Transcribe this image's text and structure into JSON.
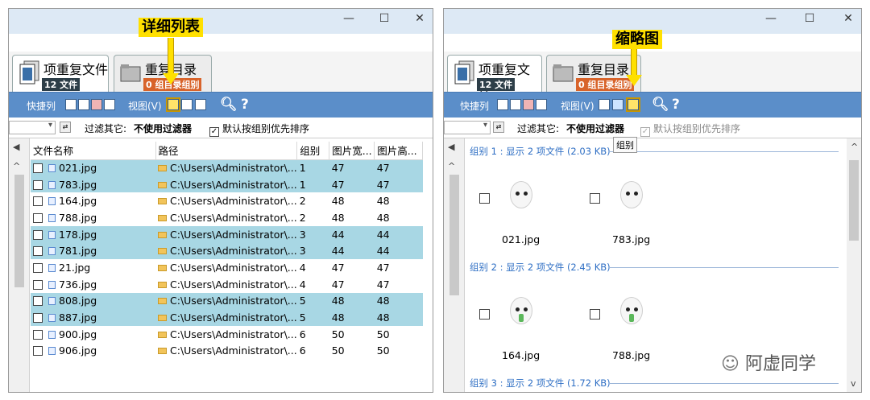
{
  "left": {
    "tabs": [
      {
        "label": "项重复文件",
        "badge": "12 文件"
      },
      {
        "label": "重复目录",
        "badge": "0 组目录组别"
      }
    ],
    "toolbar": {
      "quick": "快捷列",
      "view": "视图(V)",
      "help": "?"
    },
    "filter": {
      "other": "过滤其它:",
      "value": "不使用过滤器",
      "group_sort": "默认按组别优先排序"
    },
    "columns": [
      "文件名称",
      "路径",
      "组别",
      "图片宽...",
      "图片高..."
    ],
    "rows": [
      {
        "name": "021.jpg",
        "path": "C:\\Users\\Administrator\\...",
        "group": "1",
        "w": "47",
        "h": "47",
        "hl": true
      },
      {
        "name": "783.jpg",
        "path": "C:\\Users\\Administrator\\...",
        "group": "1",
        "w": "47",
        "h": "47",
        "hl": true
      },
      {
        "name": "164.jpg",
        "path": "C:\\Users\\Administrator\\...",
        "group": "2",
        "w": "48",
        "h": "48",
        "hl": false
      },
      {
        "name": "788.jpg",
        "path": "C:\\Users\\Administrator\\...",
        "group": "2",
        "w": "48",
        "h": "48",
        "hl": false
      },
      {
        "name": "178.jpg",
        "path": "C:\\Users\\Administrator\\...",
        "group": "3",
        "w": "44",
        "h": "44",
        "hl": true
      },
      {
        "name": "781.jpg",
        "path": "C:\\Users\\Administrator\\...",
        "group": "3",
        "w": "44",
        "h": "44",
        "hl": true
      },
      {
        "name": "21.jpg",
        "path": "C:\\Users\\Administrator\\...",
        "group": "4",
        "w": "47",
        "h": "47",
        "hl": false
      },
      {
        "name": "736.jpg",
        "path": "C:\\Users\\Administrator\\...",
        "group": "4",
        "w": "47",
        "h": "47",
        "hl": false
      },
      {
        "name": "808.jpg",
        "path": "C:\\Users\\Administrator\\...",
        "group": "5",
        "w": "48",
        "h": "48",
        "hl": true
      },
      {
        "name": "887.jpg",
        "path": "C:\\Users\\Administrator\\...",
        "group": "5",
        "w": "48",
        "h": "48",
        "hl": true
      },
      {
        "name": "900.jpg",
        "path": "C:\\Users\\Administrator\\...",
        "group": "6",
        "w": "50",
        "h": "50",
        "hl": false
      },
      {
        "name": "906.jpg",
        "path": "C:\\Users\\Administrator\\...",
        "group": "6",
        "w": "50",
        "h": "50",
        "hl": false
      }
    ],
    "callout": "详细列表"
  },
  "right": {
    "tabs": [
      {
        "label": "项重复文件",
        "badge": "12 文件"
      },
      {
        "label": "重复目录",
        "badge": "0 组目录组别"
      }
    ],
    "toolbar": {
      "quick": "快捷列",
      "view": "视图(V)",
      "help": "?"
    },
    "filter": {
      "other": "过滤其它:",
      "value": "不使用过滤器",
      "group_sort": "默认按组别优先排序"
    },
    "tooltip": "组别",
    "groups": [
      {
        "header": "组别 1 : 显示 2 项文件 (2.03 KB)",
        "files": [
          "021.jpg",
          "783.jpg"
        ],
        "cry": false
      },
      {
        "header": "组别 2 : 显示 2 项文件 (2.45 KB)",
        "files": [
          "164.jpg",
          "788.jpg"
        ],
        "cry": true
      },
      {
        "header": "组别 3 : 显示 2 项文件 (1.72 KB)",
        "files": [],
        "cry": false
      }
    ],
    "callout": "缩略图"
  },
  "watermark": "阿虚同学"
}
